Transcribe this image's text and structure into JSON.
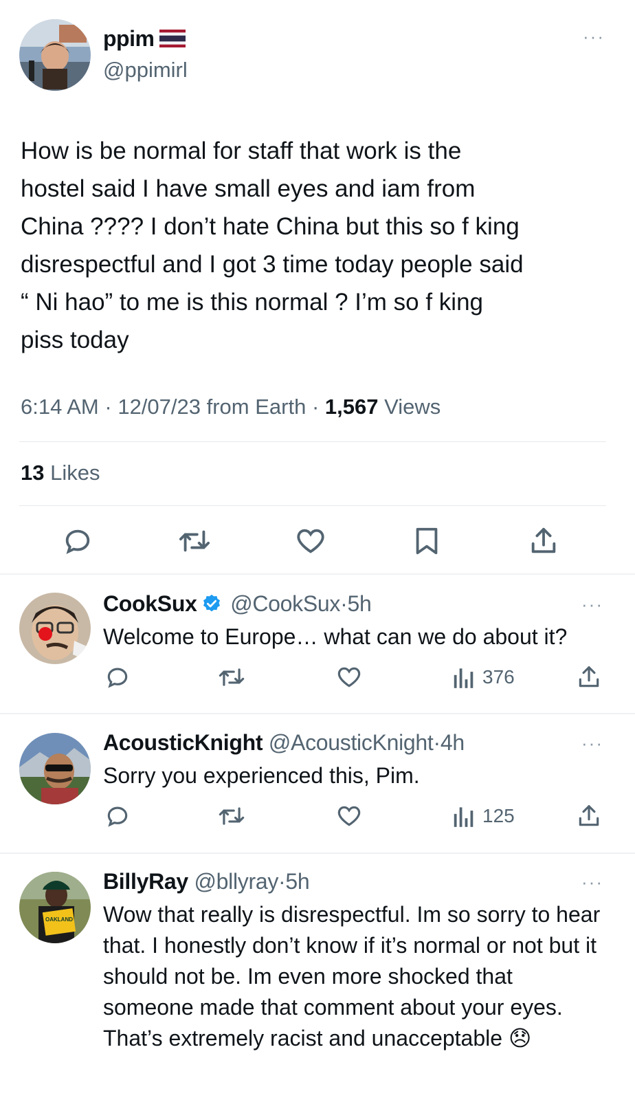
{
  "main_tweet": {
    "display_name": "ppim",
    "flag_icon": "thailand-flag",
    "handle": "@ppimirl",
    "text": "How is be normal for staff that work is the\nhostel said I have small eyes and iam from\nChina ???? I don’t hate China but this so f    king\ndisrespectful and I got 3 time today people said\n“ Ni hao” to me is this normal ? I’m so f     king\npiss today",
    "time": "6:14 AM",
    "date": "12/07/23",
    "source": "from Earth",
    "views_count": "1,567",
    "views_label": "Views",
    "likes_count": "13",
    "likes_label": "Likes",
    "sep": "·",
    "more": "···"
  },
  "replies": [
    {
      "display_name": "CookSux",
      "verified": true,
      "handle": "@CookSux",
      "time": "5h",
      "text": "Welcome to Europe… what can we do about it?",
      "views": "376"
    },
    {
      "display_name": "AcousticKnight",
      "verified": false,
      "handle": "@AcousticKnight",
      "time": "4h",
      "text": "Sorry you experienced this, Pim.",
      "views": "125"
    },
    {
      "display_name": "BillyRay",
      "verified": false,
      "handle": "@bllyray",
      "time": "5h",
      "text": "Wow that really is disrespectful. Im so sorry to hear that. I honestly don’t know if it’s normal or not but it should not be. Im even more shocked that someone made that comment about your eyes. That’s extremely racist and unacceptable 😞",
      "avatar_sign_text": "OAKLAND"
    }
  ],
  "colors": {
    "text": "#0f1419",
    "secondary": "#536471",
    "verified": "#1d9bf0",
    "divider": "#eff1f3"
  }
}
